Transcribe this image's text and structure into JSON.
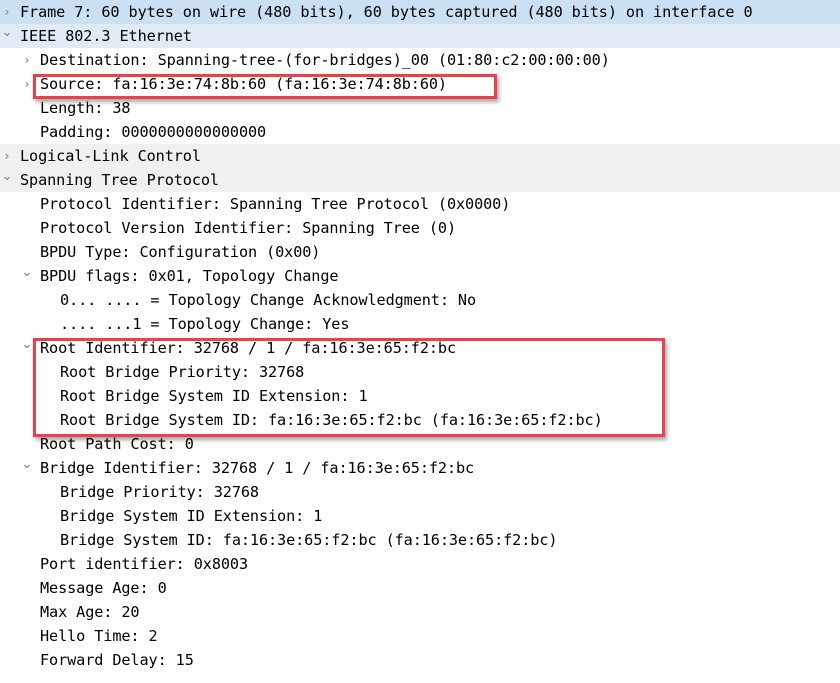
{
  "tree": [
    {
      "level": 0,
      "state": "collapsed",
      "text": "Frame 7: 60 bytes on wire (480 bits), 60 bytes captured (480 bits) on interface 0",
      "style": "selected"
    },
    {
      "level": 0,
      "state": "expanded",
      "text": "IEEE 802.3 Ethernet",
      "style": "section-open"
    },
    {
      "level": 1,
      "state": "collapsed",
      "text": "Destination: Spanning-tree-(for-bridges)_00 (01:80:c2:00:00:00)"
    },
    {
      "level": 1,
      "state": "collapsed",
      "text": "Source: fa:16:3e:74:8b:60 (fa:16:3e:74:8b:60)"
    },
    {
      "level": 1,
      "state": "leaf",
      "text": "Length: 38"
    },
    {
      "level": 1,
      "state": "leaf",
      "text": "Padding: 0000000000000000"
    },
    {
      "level": 0,
      "state": "collapsed",
      "text": "Logical-Link Control",
      "style": "section"
    },
    {
      "level": 0,
      "state": "expanded",
      "text": "Spanning Tree Protocol",
      "style": "section"
    },
    {
      "level": 1,
      "state": "leaf",
      "text": "Protocol Identifier: Spanning Tree Protocol (0x0000)"
    },
    {
      "level": 1,
      "state": "leaf",
      "text": "Protocol Version Identifier: Spanning Tree (0)"
    },
    {
      "level": 1,
      "state": "leaf",
      "text": "BPDU Type: Configuration (0x00)"
    },
    {
      "level": 1,
      "state": "expanded",
      "text": "BPDU flags: 0x01, Topology Change"
    },
    {
      "level": 2,
      "state": "leaf",
      "text": "0... .... = Topology Change Acknowledgment: No"
    },
    {
      "level": 2,
      "state": "leaf",
      "text": ".... ...1 = Topology Change: Yes"
    },
    {
      "level": 1,
      "state": "expanded",
      "text": "Root Identifier: 32768 / 1 / fa:16:3e:65:f2:bc"
    },
    {
      "level": 2,
      "state": "leaf",
      "text": "Root Bridge Priority: 32768"
    },
    {
      "level": 2,
      "state": "leaf",
      "text": "Root Bridge System ID Extension: 1"
    },
    {
      "level": 2,
      "state": "leaf",
      "text": "Root Bridge System ID: fa:16:3e:65:f2:bc (fa:16:3e:65:f2:bc)"
    },
    {
      "level": 1,
      "state": "leaf",
      "text": "Root Path Cost: 0"
    },
    {
      "level": 1,
      "state": "expanded",
      "text": "Bridge Identifier: 32768 / 1 / fa:16:3e:65:f2:bc"
    },
    {
      "level": 2,
      "state": "leaf",
      "text": "Bridge Priority: 32768"
    },
    {
      "level": 2,
      "state": "leaf",
      "text": "Bridge System ID Extension: 1"
    },
    {
      "level": 2,
      "state": "leaf",
      "text": "Bridge System ID: fa:16:3e:65:f2:bc (fa:16:3e:65:f2:bc)"
    },
    {
      "level": 1,
      "state": "leaf",
      "text": "Port identifier: 0x8003"
    },
    {
      "level": 1,
      "state": "leaf",
      "text": "Message Age: 0"
    },
    {
      "level": 1,
      "state": "leaf",
      "text": "Max Age: 20"
    },
    {
      "level": 1,
      "state": "leaf",
      "text": "Hello Time: 2"
    },
    {
      "level": 1,
      "state": "leaf",
      "text": "Forward Delay: 15"
    }
  ],
  "icons": {
    "collapsed": "›",
    "expanded": "⌄"
  },
  "annotations": {
    "highlight_color": "#e8434a",
    "highlighted_rows": [
      "Source",
      "Root Identifier group"
    ]
  }
}
